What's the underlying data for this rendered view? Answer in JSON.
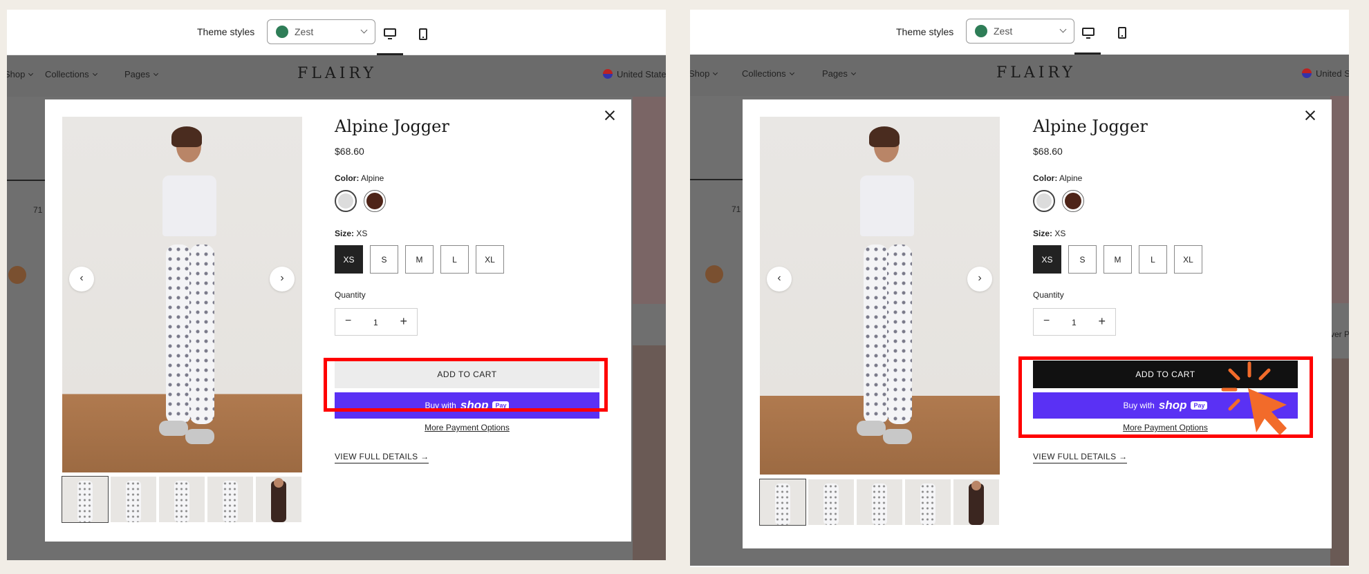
{
  "editor": {
    "theme_label": "Theme styles",
    "theme_value": "Zest",
    "theme_color": "#2e7d57"
  },
  "store": {
    "nav": [
      "Shop",
      "Collections",
      "Pages"
    ],
    "nav_left_partial": "Shop",
    "brand": "FLAIRY",
    "country": "United States",
    "bg_fragment_left": "71",
    "bg_fragment_right": "ver Pock"
  },
  "product": {
    "title": "Alpine Jogger",
    "price": "$68.60",
    "color_label": "Color:",
    "color_value": "Alpine",
    "colors": [
      "#dcdcdc",
      "#4e2418"
    ],
    "size_label": "Size:",
    "size_value": "XS",
    "sizes": [
      "XS",
      "S",
      "M",
      "L",
      "XL"
    ],
    "quantity_label": "Quantity",
    "quantity_value": "1",
    "add_to_cart": "ADD TO CART",
    "buy_with": "Buy with",
    "shop_word": "shop",
    "pay_word": "Pay",
    "more_payment": "More Payment Options",
    "view_full": "VIEW FULL DETAILS",
    "arrow": "→"
  },
  "colors": {
    "highlight": "#ff0000",
    "shop_pay": "#5a31f4",
    "cursor": "#f26b2a"
  },
  "icons": {
    "prev": "‹",
    "next": "›",
    "minus": "−",
    "plus": "+"
  }
}
